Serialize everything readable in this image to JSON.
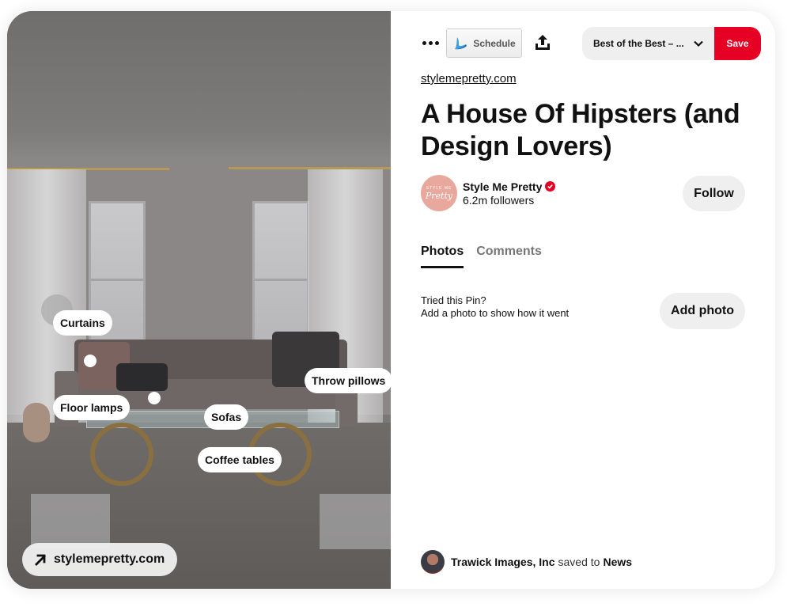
{
  "pin": {
    "image": {
      "alt": "Living room with grey tufted sofa, throw pillows, glass coffee table with ram-horn legs, white curtains",
      "hotspots": [
        {
          "label": "Curtains"
        },
        {
          "label": "Floor lamps"
        },
        {
          "label": "Throw pillows"
        },
        {
          "label": "Sofas"
        },
        {
          "label": "Coffee tables"
        }
      ],
      "visit_link": {
        "icon": "arrow-up-right-icon",
        "label": "stylemepretty.com"
      }
    },
    "toolbar": {
      "more_icon": "ellipsis-icon",
      "schedule": {
        "icon": "tailwind-logo-icon",
        "label": "Schedule"
      },
      "share_icon": "share-upload-icon",
      "board_select": {
        "value": "Best of the Best – ...",
        "icon": "chevron-down-icon"
      },
      "save_label": "Save"
    },
    "source_link": "stylemepretty.com",
    "title": "A House Of Hipsters (and Design Lovers)",
    "creator": {
      "avatar_text_top": "STYLE ME",
      "avatar_text_script": "Pretty",
      "name": "Style Me Pretty",
      "verified_icon": "verified-check-icon",
      "followers": "6.2m followers",
      "follow_label": "Follow"
    },
    "tabs": [
      {
        "label": "Photos",
        "active": true
      },
      {
        "label": "Comments",
        "active": false
      }
    ],
    "tried": {
      "line1": "Tried this Pin?",
      "line2": "Add a photo to show how it went",
      "button_label": "Add photo"
    },
    "saved_by": {
      "user": "Trawick Images, Inc",
      "connector": "saved to",
      "board": "News"
    }
  },
  "colors": {
    "save_red": "#e60023",
    "button_grey": "#efefef",
    "text": "#111111",
    "muted_tab": "#767676",
    "avatar_pink": "#e9a89d"
  }
}
